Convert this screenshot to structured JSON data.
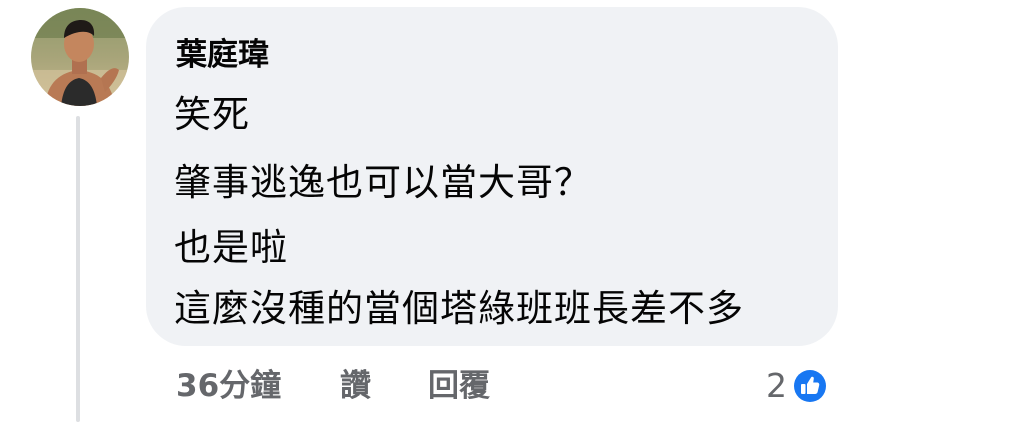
{
  "comment": {
    "author": "葉庭瑋",
    "lines": [
      "笑死",
      "肇事逃逸也可以當大哥？",
      "也是啦",
      "這麼沒種的當個塔綠班班長差不多"
    ],
    "timestamp": "36分鐘",
    "like_label": "讚",
    "reply_label": "回覆",
    "reaction_count": "2",
    "reaction_icon": "thumbs-up-icon",
    "colors": {
      "bubble": "#f0f2f5",
      "meta_text": "#65676b",
      "like_blue": "#1877f2",
      "thread_line": "#dddfe2"
    }
  }
}
